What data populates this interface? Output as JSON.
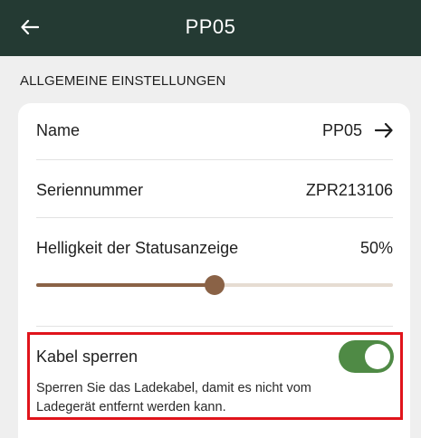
{
  "appbar": {
    "title": "PP05",
    "back_icon": "arrow-left-icon"
  },
  "section": {
    "header": "ALLGEMEINE EINSTELLUNGEN"
  },
  "settings": {
    "name": {
      "label": "Name",
      "value": "PP05",
      "icon": "arrow-right-icon"
    },
    "serial": {
      "label": "Seriennummer",
      "value": "ZPR213106"
    },
    "brightness": {
      "label": "Helligkeit der Statusanzeige",
      "value": "50%",
      "level": 0.5
    },
    "cable_lock": {
      "label": "Kabel sperren",
      "enabled": true,
      "description": "Sperren Sie das Ladekabel, damit es nicht vom Ladegerät entfernt werden kann."
    }
  },
  "colors": {
    "appbar": "#243a33",
    "slider_active": "#8a6246",
    "slider_inactive": "#e6dcd2",
    "toggle_on": "#4f8a45",
    "highlight": "#e0141b"
  }
}
